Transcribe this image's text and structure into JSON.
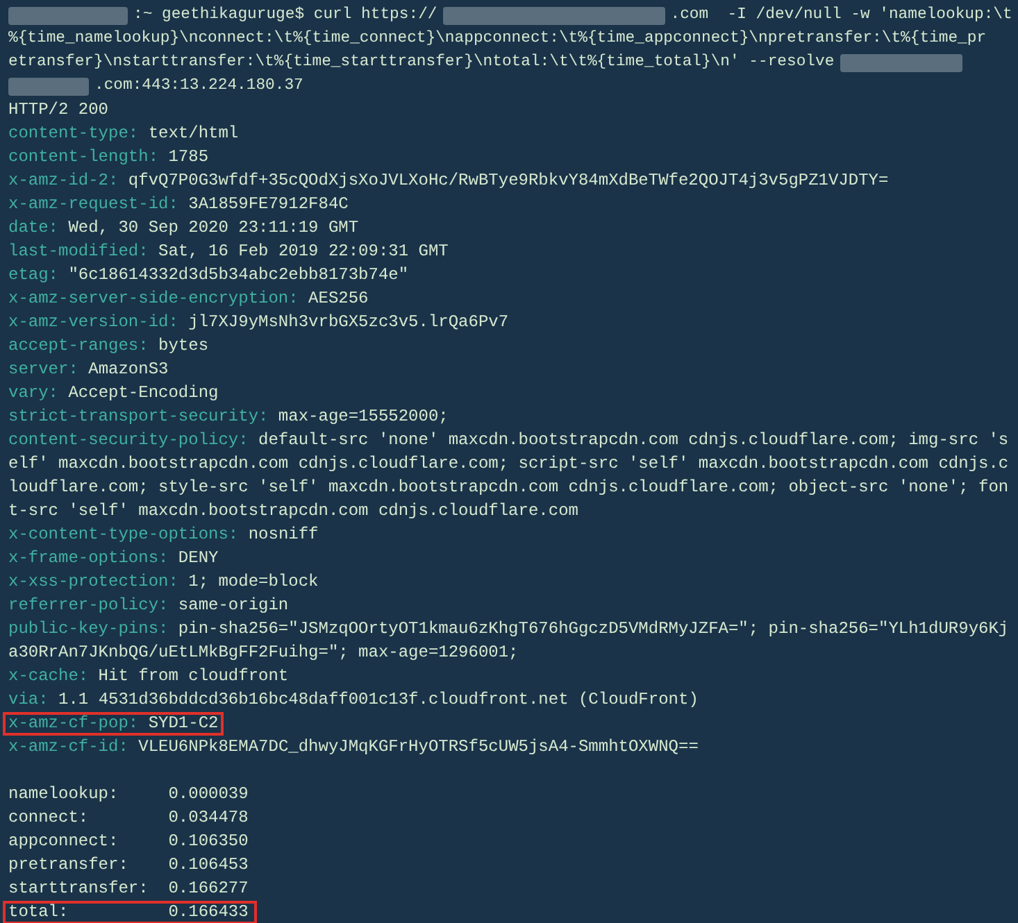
{
  "command_lines": [
    [
      {
        "kind": "redacted"
      },
      {
        "kind": "text",
        "text": ":~ geethikaguruge$ curl https://"
      },
      {
        "kind": "redacted"
      },
      {
        "kind": "text",
        "text": ".com  -I /dev/null -w 'namelookup:\\t"
      }
    ],
    [
      {
        "kind": "text",
        "text": "%{time_namelookup}\\nconnect:\\t%{time_connect}\\nappconnect:\\t%{time_appconnect}\\npretransfer:\\t%{time_pr"
      }
    ],
    [
      {
        "kind": "text",
        "text": "etransfer}\\nstarttransfer:\\t%{time_starttransfer}\\ntotal:\\t\\t%{time_total}\\n' --resolve"
      },
      {
        "kind": "redacted"
      }
    ],
    [
      {
        "kind": "redacted"
      },
      {
        "kind": "text",
        "text": ".com:443:13.224.180.37"
      }
    ]
  ],
  "status_line": "HTTP/2 200",
  "headers": [
    {
      "name": "content-type:",
      "value": "text/html",
      "highlighted": false
    },
    {
      "name": "content-length:",
      "value": "1785",
      "highlighted": false
    },
    {
      "name": "x-amz-id-2:",
      "value": "qfvQ7P0G3wfdf+35cQOdXjsXoJVLXoHc/RwBTye9RbkvY84mXdBeTWfe2QOJT4j3v5gPZ1VJDTY=",
      "highlighted": false
    },
    {
      "name": "x-amz-request-id:",
      "value": "3A1859FE7912F84C",
      "highlighted": false
    },
    {
      "name": "date:",
      "value": "Wed, 30 Sep 2020 23:11:19 GMT",
      "highlighted": false
    },
    {
      "name": "last-modified:",
      "value": "Sat, 16 Feb 2019 22:09:31 GMT",
      "highlighted": false
    },
    {
      "name": "etag:",
      "value": "\"6c18614332d3d5b34abc2ebb8173b74e\"",
      "highlighted": false
    },
    {
      "name": "x-amz-server-side-encryption:",
      "value": "AES256",
      "highlighted": false
    },
    {
      "name": "x-amz-version-id:",
      "value": "jl7XJ9yMsNh3vrbGX5zc3v5.lrQa6Pv7",
      "highlighted": false
    },
    {
      "name": "accept-ranges:",
      "value": "bytes",
      "highlighted": false
    },
    {
      "name": "server:",
      "value": "AmazonS3",
      "highlighted": false
    },
    {
      "name": "vary:",
      "value": "Accept-Encoding",
      "highlighted": false
    },
    {
      "name": "strict-transport-security:",
      "value": "max-age=15552000;",
      "highlighted": false
    },
    {
      "name": "content-security-policy:",
      "value": "default-src 'none' maxcdn.bootstrapcdn.com cdnjs.cloudflare.com; img-src 'self' maxcdn.bootstrapcdn.com cdnjs.cloudflare.com; script-src 'self' maxcdn.bootstrapcdn.com cdnjs.cloudflare.com; style-src 'self' maxcdn.bootstrapcdn.com cdnjs.cloudflare.com; object-src 'none'; font-src 'self' maxcdn.bootstrapcdn.com cdnjs.cloudflare.com",
      "highlighted": false
    },
    {
      "name": "x-content-type-options:",
      "value": "nosniff",
      "highlighted": false
    },
    {
      "name": "x-frame-options:",
      "value": "DENY",
      "highlighted": false
    },
    {
      "name": "x-xss-protection:",
      "value": "1; mode=block",
      "highlighted": false
    },
    {
      "name": "referrer-policy:",
      "value": "same-origin",
      "highlighted": false
    },
    {
      "name": "public-key-pins:",
      "value": "pin-sha256=\"JSMzqOOrtyOT1kmau6zKhgT676hGgczD5VMdRMyJZFA=\"; pin-sha256=\"YLh1dUR9y6Kja30RrAn7JKnbQG/uEtLMkBgFF2Fuihg=\"; max-age=1296001;",
      "highlighted": false
    },
    {
      "name": "x-cache:",
      "value": "Hit from cloudfront",
      "highlighted": false
    },
    {
      "name": "via:",
      "value": "1.1 4531d36bddcd36b16bc48daff001c13f.cloudfront.net (CloudFront)",
      "highlighted": false
    },
    {
      "name": "x-amz-cf-pop:",
      "value": "SYD1-C2",
      "highlighted": true
    },
    {
      "name": "x-amz-cf-id:",
      "value": "VLEU6NPk8EMA7DC_dhwyJMqKGFrHyOTRSf5cUW5jsA4-SmmhtOXWNQ==",
      "highlighted": false
    }
  ],
  "timings": [
    {
      "label": "namelookup:",
      "value": "0.000039",
      "highlighted": false
    },
    {
      "label": "connect:",
      "value": "0.034478",
      "highlighted": false
    },
    {
      "label": "appconnect:",
      "value": "0.106350",
      "highlighted": false
    },
    {
      "label": "pretransfer:",
      "value": "0.106453",
      "highlighted": false
    },
    {
      "label": "starttransfer:",
      "value": "0.166277",
      "highlighted": false
    },
    {
      "label": "total:",
      "value": "0.166433",
      "highlighted": true
    }
  ]
}
